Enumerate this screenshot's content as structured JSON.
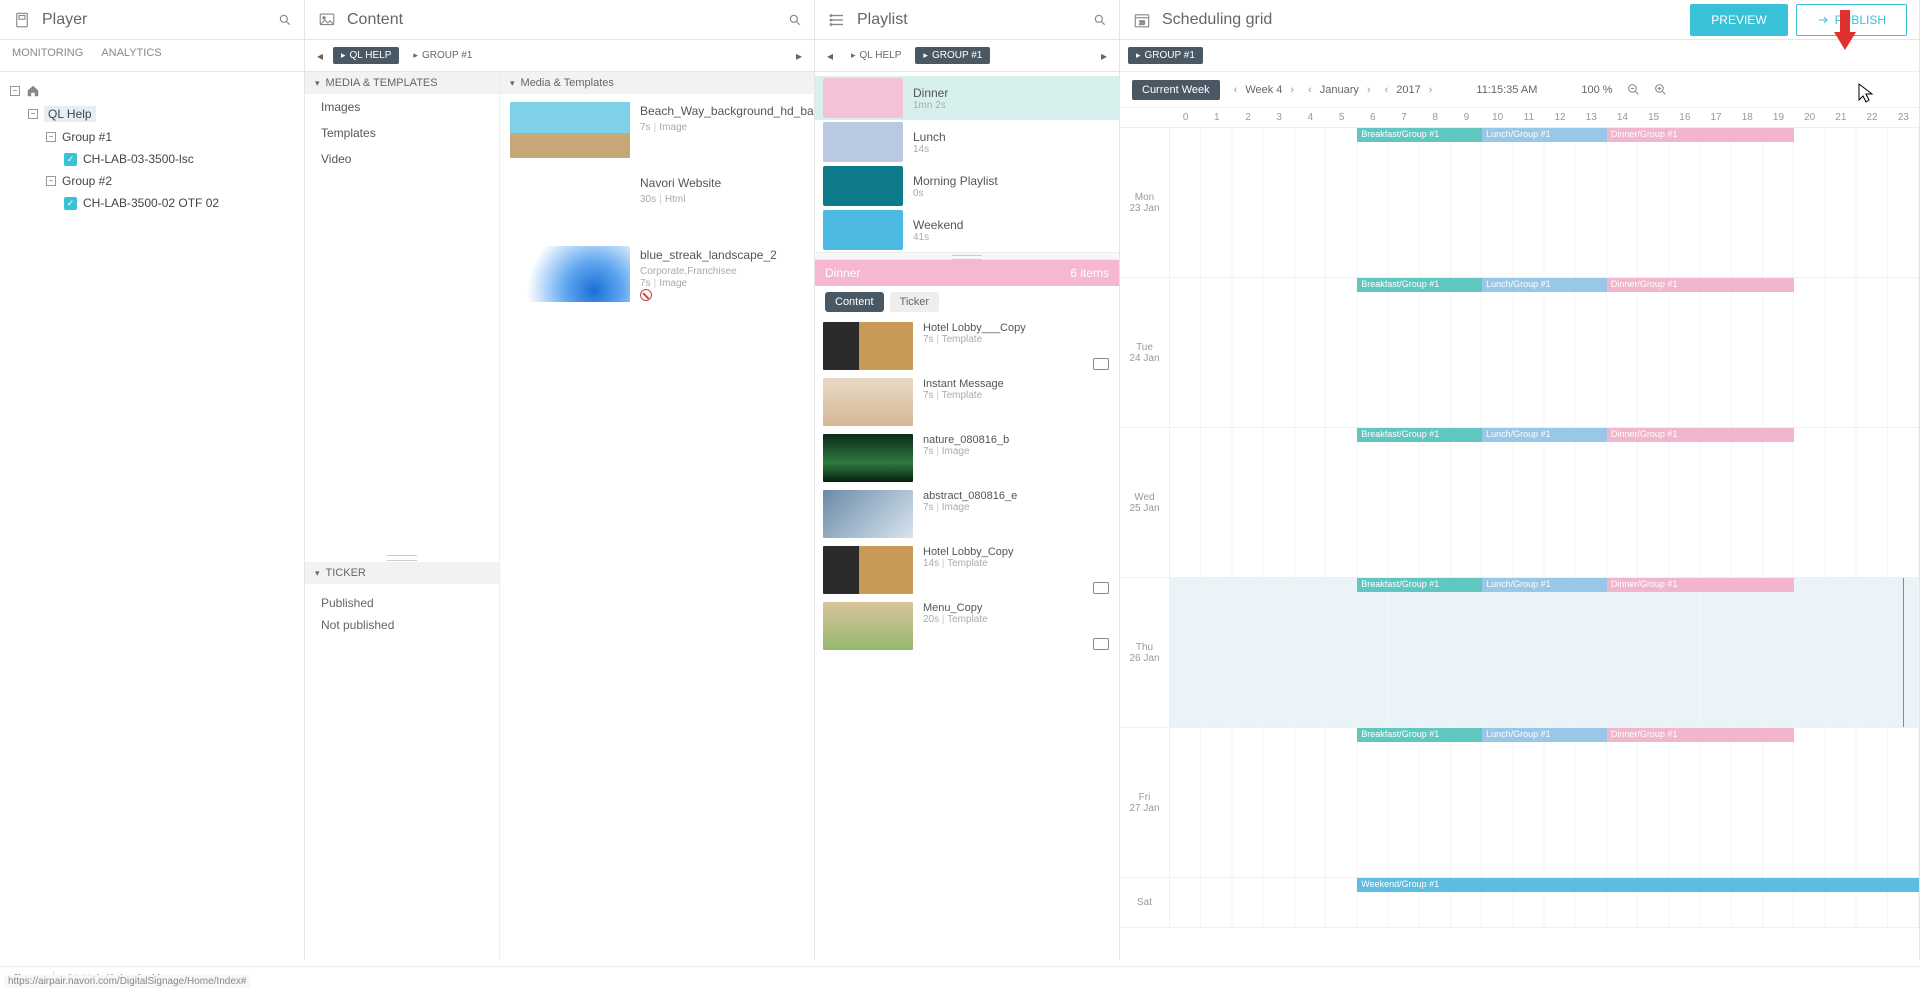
{
  "player": {
    "title": "Player",
    "tabs": {
      "monitoring": "MONITORING",
      "analytics": "ANALYTICS"
    },
    "tree": {
      "root": "QL Help",
      "groups": [
        {
          "name": "Group #1",
          "devices": [
            {
              "name": "CH-LAB-03-3500-lsc",
              "checked": true
            }
          ]
        },
        {
          "name": "Group #2",
          "devices": [
            {
              "name": "CH-LAB-3500-02 OTF 02",
              "checked": true
            }
          ]
        }
      ]
    }
  },
  "content": {
    "title": "Content",
    "breadcrumbs": [
      {
        "label": "QL HELP"
      },
      {
        "label": "GROUP #1"
      }
    ],
    "mediaHeader": "MEDIA & TEMPLATES",
    "categories": [
      "Images",
      "Templates",
      "Video"
    ],
    "rightHeader": "Media & Templates",
    "items": [
      {
        "title": "Beach_Way_background_hd_ba",
        "sub1": "",
        "dur": "7s",
        "type": "Image",
        "thumb": "linear-gradient(180deg,#7fd1e8 55%,#c7a678 55%)"
      },
      {
        "title": "Navori Website",
        "sub1": "",
        "dur": "30s",
        "type": "Html",
        "thumb": "#fff"
      },
      {
        "title": "blue_streak_landscape_2",
        "sub1": "Corporate,Franchisee",
        "dur": "7s",
        "type": "Image",
        "thumb": "radial-gradient(circle at 70% 80%, #1a6fd6 0%, #5fa6f0 30%, #fff 70%)",
        "forbid": true
      }
    ],
    "tickerHeader": "TICKER",
    "ticker": [
      "Published",
      "Not published"
    ]
  },
  "playlist": {
    "title": "Playlist",
    "breadcrumbs": [
      {
        "label": "QL HELP",
        "outline": true
      },
      {
        "label": "GROUP #1"
      }
    ],
    "items": [
      {
        "title": "Dinner",
        "dur": "1mn 2s",
        "color": "#f5c1d8",
        "selected": true
      },
      {
        "title": "Lunch",
        "dur": "14s",
        "color": "#b9c9e2"
      },
      {
        "title": "Morning Playlist",
        "dur": "0s",
        "color": "#0e7b8a"
      },
      {
        "title": "Weekend",
        "dur": "41s",
        "color": "#4bb9e0"
      }
    ],
    "sectionName": "Dinner",
    "sectionCount": "6 items",
    "pills": {
      "content": "Content",
      "ticker": "Ticker"
    },
    "contentItems": [
      {
        "title": "Hotel Lobby___Copy",
        "dur": "7s",
        "type": "Template",
        "thumb": "linear-gradient(90deg,#2b2b2b 40%,#c79a55 40%)",
        "monitor": true
      },
      {
        "title": "Instant Message",
        "dur": "7s",
        "type": "Template",
        "thumb": "linear-gradient(180deg,#e8d9c6,#d6b896)"
      },
      {
        "title": "nature_080816_b",
        "dur": "7s",
        "type": "Image",
        "thumb": "linear-gradient(180deg,#0a2a18,#2e7a3e 60%,#062010)"
      },
      {
        "title": "abstract_080816_e",
        "dur": "7s",
        "type": "Image",
        "thumb": "linear-gradient(135deg,#6b8aa8,#d8e4ee)"
      },
      {
        "title": "Hotel Lobby_Copy",
        "dur": "14s",
        "type": "Template",
        "thumb": "linear-gradient(90deg,#2b2b2b 40%,#c79a55 40%)",
        "monitor": true
      },
      {
        "title": "Menu_Copy",
        "dur": "20s",
        "type": "Template",
        "thumb": "linear-gradient(180deg,#d9c49a,#95b86f)",
        "monitor": true
      }
    ]
  },
  "schedule": {
    "title": "Scheduling grid",
    "chip": "GROUP #1",
    "preview": "PREVIEW",
    "publish": "PUBLISH",
    "currentWeek": "Current Week",
    "week": "Week 4",
    "month": "January",
    "year": "2017",
    "time": "11:15:35 AM",
    "zoom": "100 %",
    "hours": [
      "0",
      "1",
      "2",
      "3",
      "4",
      "5",
      "6",
      "7",
      "8",
      "9",
      "10",
      "11",
      "12",
      "13",
      "14",
      "15",
      "16",
      "17",
      "18",
      "19",
      "20",
      "21",
      "22",
      "23"
    ],
    "days": [
      {
        "dow": "Mon",
        "date": "23 Jan",
        "events": [
          {
            "type": "breakfast",
            "label": "Breakfast/Group #1",
            "start": 6,
            "end": 10
          },
          {
            "type": "lunch",
            "label": "Lunch/Group #1",
            "start": 10,
            "end": 14
          },
          {
            "type": "dinner",
            "label": "Dinner/Group #1",
            "start": 14,
            "end": 20
          }
        ]
      },
      {
        "dow": "Tue",
        "date": "24 Jan",
        "events": [
          {
            "type": "breakfast",
            "label": "Breakfast/Group #1",
            "start": 6,
            "end": 10
          },
          {
            "type": "lunch",
            "label": "Lunch/Group #1",
            "start": 10,
            "end": 14
          },
          {
            "type": "dinner",
            "label": "Dinner/Group #1",
            "start": 14,
            "end": 20
          }
        ]
      },
      {
        "dow": "Wed",
        "date": "25 Jan",
        "events": [
          {
            "type": "breakfast",
            "label": "Breakfast/Group #1",
            "start": 6,
            "end": 10
          },
          {
            "type": "lunch",
            "label": "Lunch/Group #1",
            "start": 10,
            "end": 14
          },
          {
            "type": "dinner",
            "label": "Dinner/Group #1",
            "start": 14,
            "end": 20
          }
        ]
      },
      {
        "dow": "Thu",
        "date": "26 Jan",
        "highlight": true,
        "marker": 23.5,
        "events": [
          {
            "type": "breakfast",
            "label": "Breakfast/Group #1",
            "start": 6,
            "end": 10
          },
          {
            "type": "lunch",
            "label": "Lunch/Group #1",
            "start": 10,
            "end": 14
          },
          {
            "type": "dinner",
            "label": "Dinner/Group #1",
            "start": 14,
            "end": 20
          }
        ]
      },
      {
        "dow": "Fri",
        "date": "27 Jan",
        "events": [
          {
            "type": "breakfast",
            "label": "Breakfast/Group #1",
            "start": 6,
            "end": 10
          },
          {
            "type": "lunch",
            "label": "Lunch/Group #1",
            "start": 10,
            "end": 14
          },
          {
            "type": "dinner",
            "label": "Dinner/Group #1",
            "start": 14,
            "end": 20
          }
        ]
      },
      {
        "dow": "Sat",
        "date": "",
        "events": [
          {
            "type": "weekend",
            "label": "Weekend/Group #1",
            "start": 6,
            "end": 24
          }
        ]
      }
    ]
  },
  "footer": {
    "path": "QL Help/John Smith",
    "url": "https://airpair.navori.com/DigitalSignage/Home/Index#"
  }
}
